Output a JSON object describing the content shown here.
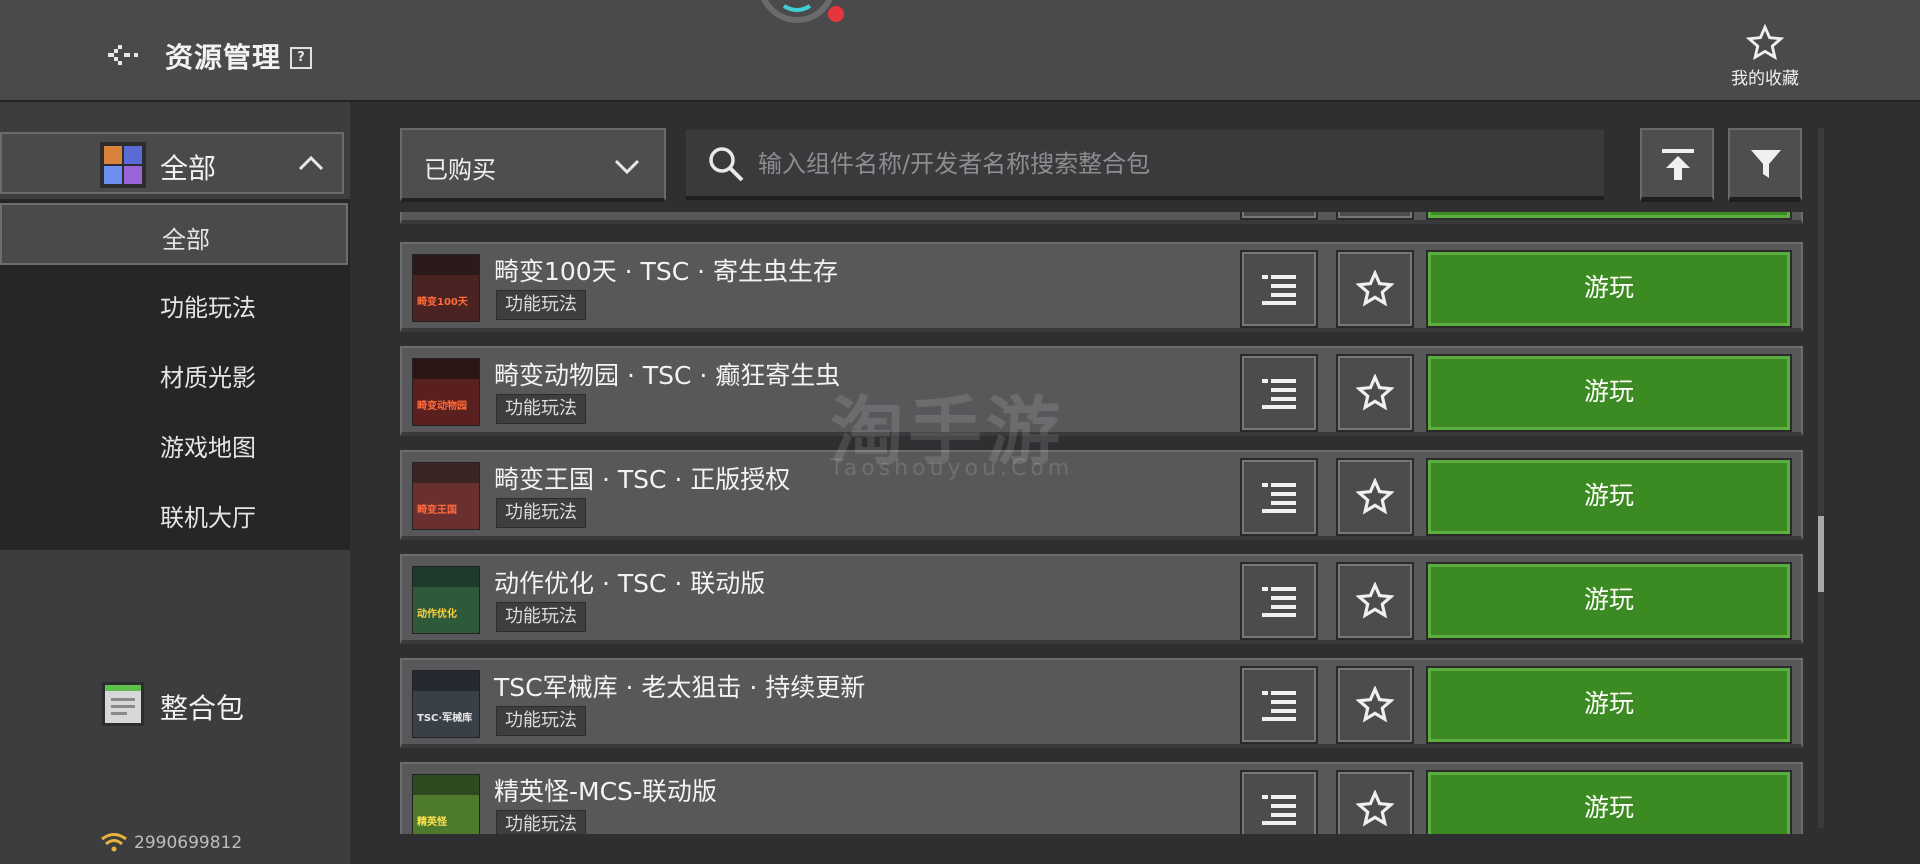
{
  "header": {
    "title": "资源管理",
    "help": "?",
    "favorites_label": "我的收藏"
  },
  "sidebar": {
    "category": "全部",
    "sub_items": [
      "全部",
      "功能玩法",
      "材质光影",
      "游戏地图",
      "联机大厅"
    ],
    "pack_label": "整合包",
    "network_id": "2990699812"
  },
  "toolbar": {
    "filter_value": "已购买",
    "search_placeholder": "输入组件名称/开发者名称搜索整合包"
  },
  "items": [
    {
      "title": "畸变100天 · TSC · 寄生虫生存",
      "tag": "功能玩法",
      "play": "游玩",
      "thumb_text": "畸变100天"
    },
    {
      "title": "畸变动物园 · TSC · 癫狂寄生虫",
      "tag": "功能玩法",
      "play": "游玩",
      "thumb_text": "畸变动物园"
    },
    {
      "title": "畸变王国 · TSC · 正版授权",
      "tag": "功能玩法",
      "play": "游玩",
      "thumb_text": "畸变王国"
    },
    {
      "title": "动作优化 · TSC · 联动版",
      "tag": "功能玩法",
      "play": "游玩",
      "thumb_text": "动作优化"
    },
    {
      "title": "TSC军械库 · 老太狙击 · 持续更新",
      "tag": "功能玩法",
      "play": "游玩",
      "thumb_text": "TSC·军械库"
    },
    {
      "title": "精英怪-MCS-联动版",
      "tag": "功能玩法",
      "play": "游玩",
      "thumb_text": "精英怪"
    }
  ],
  "watermark": {
    "main": "淘手游",
    "sub": "Taoshouyou.Com"
  },
  "colors": {
    "play_green": "#3c8a22",
    "accent_red": "#e8343b",
    "accent_teal": "#3fd1d6"
  },
  "scroll": {
    "position_fraction": 0.55
  }
}
